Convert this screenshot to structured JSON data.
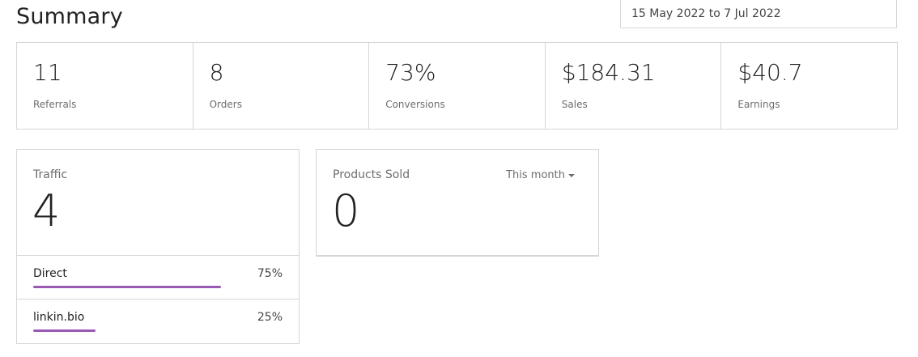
{
  "header": {
    "title": "Summary",
    "date_range": "15 May 2022 to 7 Jul 2022"
  },
  "stats": [
    {
      "value": "11",
      "label": "Referrals"
    },
    {
      "value": "8",
      "label": "Orders"
    },
    {
      "value": "73%",
      "label": "Conversions"
    },
    {
      "value": "$184.31",
      "label": "Sales"
    },
    {
      "value": "$40.7",
      "label": "Earnings"
    }
  ],
  "traffic": {
    "label": "Traffic",
    "value": "4",
    "sources": [
      {
        "name": "Direct",
        "percent_text": "75%",
        "percent": 75
      },
      {
        "name": "linkin.bio",
        "percent_text": "25%",
        "percent": 25
      }
    ],
    "bar_color": "#9b59b6"
  },
  "products": {
    "label": "Products Sold",
    "value": "0",
    "period": "This month"
  }
}
